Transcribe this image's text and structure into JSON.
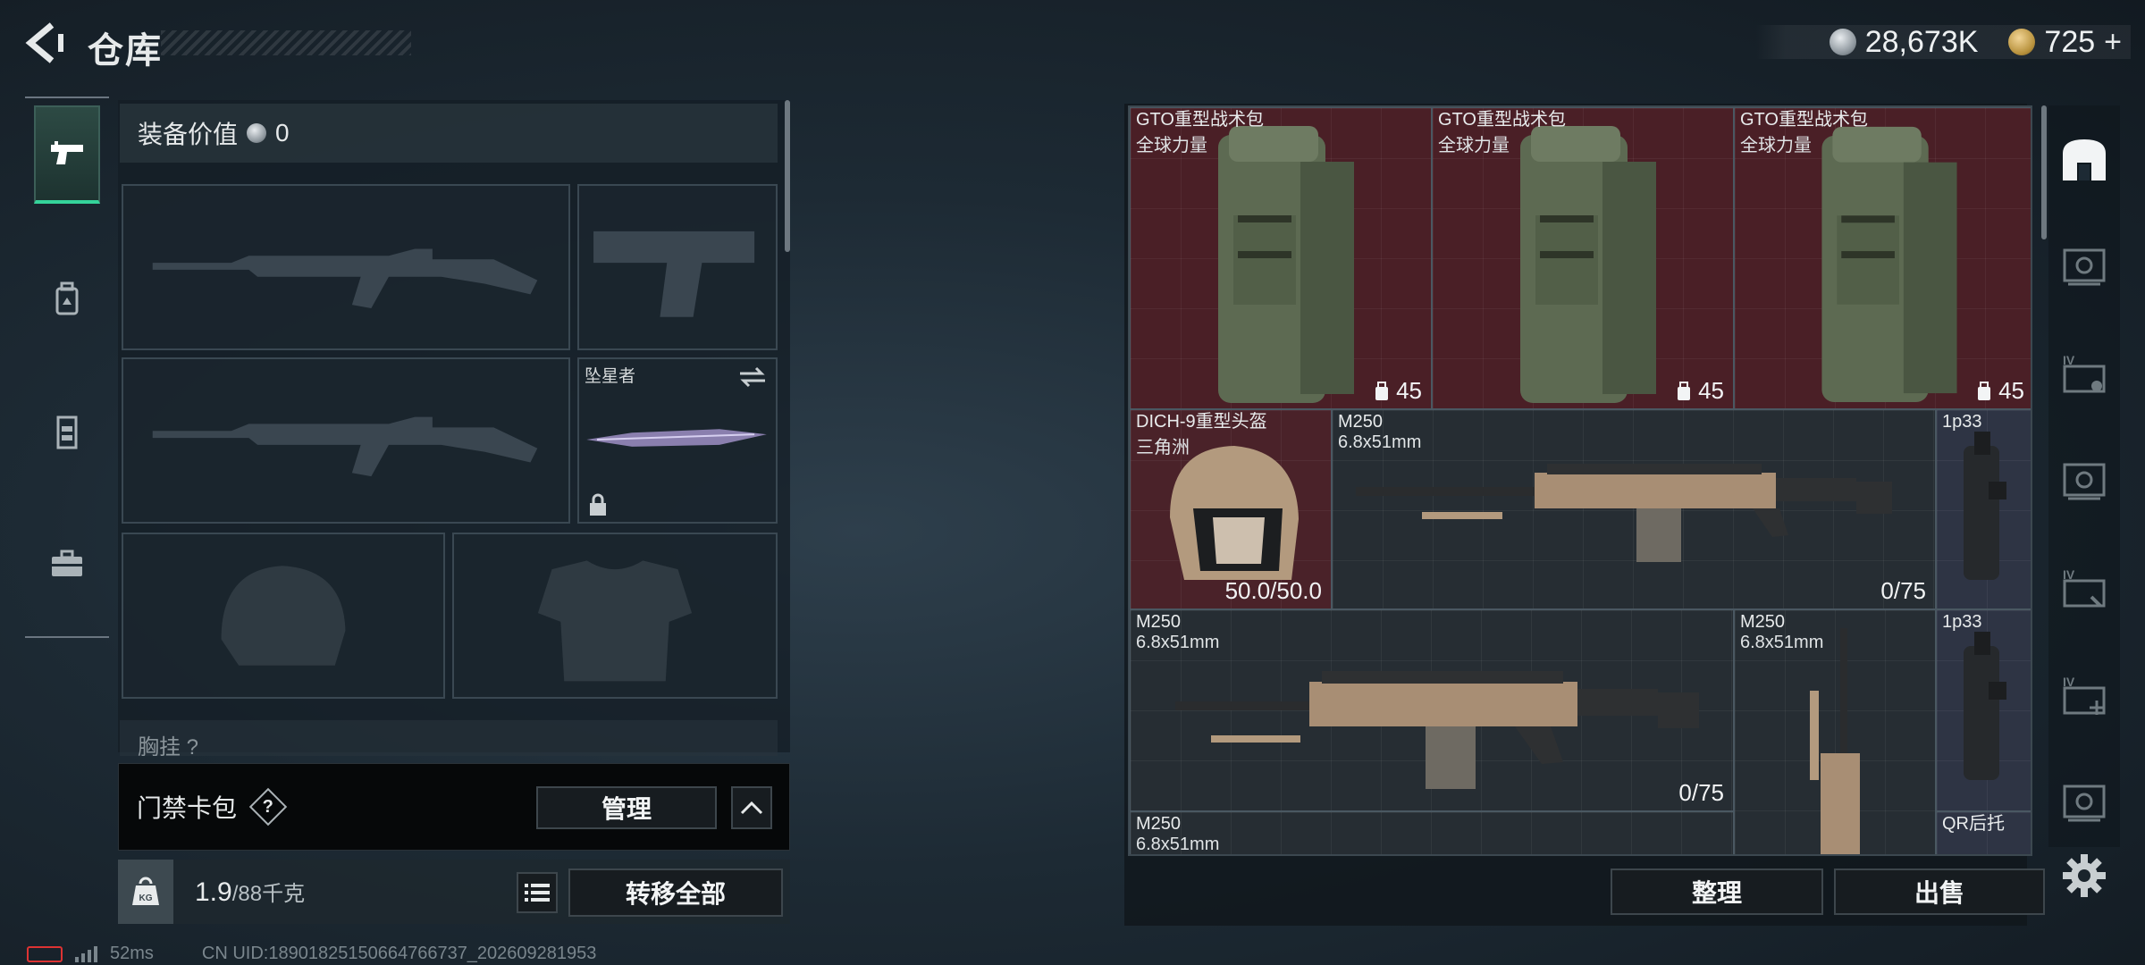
{
  "header": {
    "title": "仓库",
    "currency_a": "28,673K",
    "currency_b": "725",
    "currency_b_suffix": "+"
  },
  "side_tabs": [
    {
      "name": "weapons",
      "icon": "pistol-icon",
      "active": true
    },
    {
      "name": "backpack",
      "icon": "backpack-icon",
      "active": false
    },
    {
      "name": "armor",
      "icon": "vest-icon",
      "active": false
    },
    {
      "name": "case",
      "icon": "briefcase-icon",
      "active": false
    }
  ],
  "loadout": {
    "equip_value_label": "装备价值",
    "equip_value": "0",
    "melee_label": "坠星者",
    "chest_peek": "胸挂 ?",
    "access_label": "门禁卡包",
    "help": "?",
    "manage_label": "管理",
    "weight_current": "1.9",
    "weight_max": "/88千克",
    "transfer_label": "转移全部"
  },
  "storage": {
    "items": [
      {
        "name": "GTO重型战术包",
        "sub": "全球力量",
        "count": "45"
      },
      {
        "name": "GTO重型战术包",
        "sub": "全球力量",
        "count": "45"
      },
      {
        "name": "GTO重型战术包",
        "sub": "全球力量",
        "count": "45"
      },
      {
        "name": "DICH-9重型头盔",
        "sub": "三角洲",
        "count": "50.0/50.0"
      },
      {
        "name": "M250",
        "sub": "6.8x51mm",
        "count": "0/75"
      },
      {
        "name": "1p33",
        "sub": "",
        "count": ""
      },
      {
        "name": "M250",
        "sub": "6.8x51mm",
        "count": "0/75"
      },
      {
        "name": "M250",
        "sub": "6.8x51mm",
        "count": ""
      },
      {
        "name": "1p33",
        "sub": "",
        "count": ""
      },
      {
        "name": "M250",
        "sub": "6.8x51mm",
        "count": ""
      },
      {
        "name": "QR后托",
        "sub": "",
        "count": ""
      }
    ],
    "sort_label": "整理",
    "sell_label": "出售"
  },
  "status": {
    "ping": "52ms",
    "uid": "CN UID:18901825150664766737_202609281953"
  },
  "colors": {
    "accent_green": "#35d39a",
    "rarity_red": "#4a1f26",
    "rarity_blue": "#2e3444"
  }
}
